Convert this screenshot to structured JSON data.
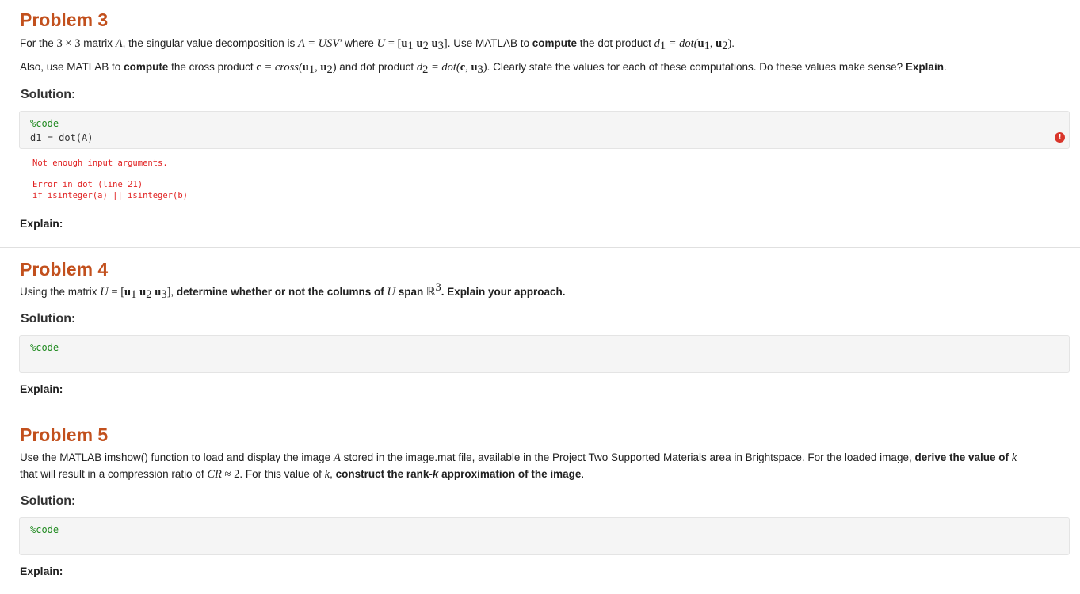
{
  "problem3": {
    "title": "Problem 3",
    "line1": {
      "t1": "For the ",
      "m_dims": "3 × 3",
      "t2": " matrix ",
      "m_A": "A",
      "t3": ", the singular value decomposition is ",
      "m_svd": "A = USV′",
      "t4": " where ",
      "m_U": "U",
      "m_eq": " = [",
      "u": "u",
      "sub1": "1",
      "sub2": "2",
      "sub3": "3",
      "m_close": "]",
      "t5": ". Use MATLAB to ",
      "b_compute": "compute",
      "t6": " the dot product ",
      "m_d1": "d",
      "m_d1sub": "1",
      "m_dot": " = dot(",
      "m_comma": ", ",
      "m_end": ")",
      "t7": "."
    },
    "line2": {
      "t1": "Also, use MATLAB to ",
      "b_compute": "compute",
      "t2": " the cross product ",
      "m_c": "c",
      "m_cross": " = cross(",
      "t3": " and dot product ",
      "m_d2": "d",
      "m_d2sub": "2",
      "m_dot2": " = dot(",
      "m_c2": "c",
      "t4": ". Clearly state the values for each of these computations. Do these values make sense? ",
      "b_explain": "Explain",
      "t5": "."
    },
    "solution": "Solution:",
    "code": [
      "%code",
      "d1 = dot(A)"
    ],
    "error_line1": "Not enough input arguments.",
    "error_in": "Error in ",
    "error_fn": "dot",
    "error_line": "(line 21)",
    "error_code": "if isinteger(a) || isinteger(b)",
    "error_icon": "!",
    "explain": "Explain:"
  },
  "problem4": {
    "title": "Problem 4",
    "t1": "Using the matrix ",
    "t2": ", ",
    "b1": "determine whether or not the columns of ",
    "m_U": "U",
    "b2": " span ",
    "m_R": "ℝ",
    "m_Rsup": "3",
    "b3": ". Explain your approach.",
    "solution": "Solution:",
    "code": [
      "%code"
    ],
    "explain": "Explain:"
  },
  "problem5": {
    "title": "Problem 5",
    "line1_t1": "Use the MATLAB imshow() function to load and display the image ",
    "m_A": "A",
    "line1_t2": " stored in the image.mat file, available in the Project Two Supported Materials area in Brightspace. For the loaded image, ",
    "b_derive": "derive the value of ",
    "m_k": "k",
    "line2_t1": "that will result in a compression ratio of ",
    "m_CR": "CR",
    "m_approx": " ≈ 2",
    "line2_t2": ". For this value of ",
    "line2_t3": ", ",
    "b_construct": "construct the rank-",
    "b_k": "k",
    "b_construct2": " approximation of the image",
    "line2_t4": ".",
    "solution": "Solution:",
    "code": [
      "%code"
    ],
    "explain": "Explain:"
  }
}
